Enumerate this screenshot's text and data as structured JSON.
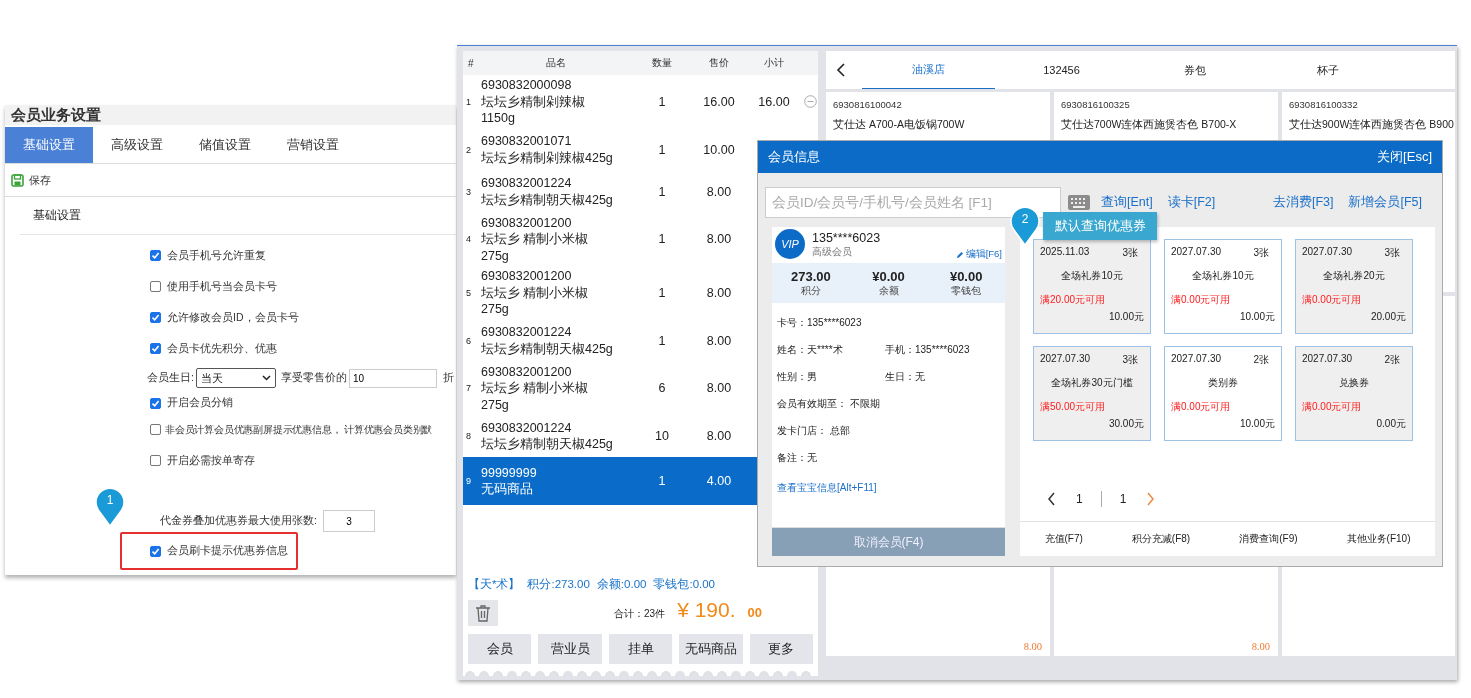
{
  "settings": {
    "title": "会员业务设置",
    "tabs": [
      {
        "label": "基础设置",
        "selected": true
      },
      {
        "label": "高级设置",
        "selected": false
      },
      {
        "label": "储值设置",
        "selected": false
      },
      {
        "label": "营销设置",
        "selected": false
      }
    ],
    "save": "保存",
    "section": "基础设置",
    "options": [
      {
        "kind": "checkbox",
        "label": "会员手机号允许重复",
        "checked": true
      },
      {
        "kind": "checkbox",
        "label": "使用手机号当会员卡号",
        "checked": false
      },
      {
        "kind": "checkbox",
        "label": "允许修改会员ID，会员卡号",
        "checked": true
      },
      {
        "kind": "checkbox",
        "label": "会员卡优先积分、优惠",
        "checked": true
      },
      {
        "kind": "birthday",
        "label": "会员生日:",
        "select": "当天",
        "after": "享受零售价的",
        "value": "10",
        "unit": "折"
      },
      {
        "kind": "checkbox",
        "label": "开启会员分销",
        "checked": true
      },
      {
        "kind": "checkbox",
        "label": "非会员计算会员优惠副屏提示优惠信息， 计算优惠会员类别默",
        "checked": false
      },
      {
        "kind": "checkbox",
        "label": "开启必需按单寄存",
        "checked": false
      },
      {
        "kind": "count",
        "label": "代金券叠加优惠券最大使用张数:",
        "value": "3"
      },
      {
        "kind": "checkbox",
        "label": "会员刷卡提示优惠券信息",
        "checked": true,
        "highlighted": true
      }
    ],
    "callout": {
      "number": "1"
    }
  },
  "cart": {
    "columns": [
      "#",
      "品名",
      "数量",
      "售价",
      "小计"
    ],
    "rows": [
      {
        "index": "1",
        "lines": [
          "6930832000098",
          "坛坛乡精制剁辣椒",
          "1150g"
        ],
        "qty": "1",
        "price": "16.00",
        "subtotal": "16.00",
        "selected": false
      },
      {
        "index": "2",
        "lines": [
          "6930832001071",
          "坛坛乡精制剁辣椒425g"
        ],
        "qty": "1",
        "price": "10.00",
        "selected": false
      },
      {
        "index": "3",
        "lines": [
          "6930832001224",
          "坛坛乡精制朝天椒425g"
        ],
        "qty": "1",
        "price": "8.00",
        "selected": false
      },
      {
        "index": "4",
        "lines": [
          "6930832001200",
          "坛坛乡 精制小米椒",
          "275g"
        ],
        "qty": "1",
        "price": "8.00",
        "selected": false
      },
      {
        "index": "5",
        "lines": [
          "6930832001200",
          "坛坛乡 精制小米椒",
          "275g"
        ],
        "qty": "1",
        "price": "8.00",
        "selected": false
      },
      {
        "index": "6",
        "lines": [
          "6930832001224",
          "坛坛乡精制朝天椒425g"
        ],
        "qty": "1",
        "price": "8.00",
        "selected": false
      },
      {
        "index": "7",
        "lines": [
          "6930832001200",
          "坛坛乡 精制小米椒",
          "275g"
        ],
        "qty": "6",
        "price": "8.00",
        "selected": false
      },
      {
        "index": "8",
        "lines": [
          "6930832001224",
          "坛坛乡精制朝天椒425g"
        ],
        "qty": "10",
        "price": "8.00",
        "selected": false
      },
      {
        "index": "9",
        "lines": [
          "99999999",
          "无码商品"
        ],
        "qty": "1",
        "price": "4.00",
        "selected": true
      }
    ],
    "member_line": [
      "【天*术】",
      "积分:273.00",
      "余额:0.00",
      "零钱包:0.00"
    ],
    "total_label": "合计：23件",
    "total_main": "¥ 190.",
    "total_cents": "00",
    "buttons": [
      "会员",
      "营业员",
      "挂单",
      "无码商品",
      "更多"
    ]
  },
  "catalog": {
    "tabs": [
      {
        "label": "油溪店",
        "selected": true
      },
      {
        "label": "132456",
        "selected": false
      },
      {
        "label": "券包",
        "selected": false
      },
      {
        "label": "杯子",
        "selected": false
      }
    ],
    "products": [
      {
        "code": "6930816100042",
        "name": "艾仕达 A700-A电饭锅700W"
      },
      {
        "code": "6930816100325",
        "name": "艾仕达700W连体西施煲杏色 B700-X"
      },
      {
        "code": "6930816100332",
        "name": "艾仕达900W连体西施煲杏色 B900"
      },
      {
        "price": "8.00"
      },
      {
        "price": "8.00"
      }
    ]
  },
  "member_dialog": {
    "title": "会员信息",
    "close": "关闭[Esc]",
    "search_placeholder": "会员ID/会员号/手机号/会员姓名 [F1]",
    "links": [
      "查询[Ent]",
      "读卡[F2]"
    ],
    "right_links": [
      "去消费[F3]",
      "新增会员[F5]"
    ],
    "callout": {
      "number": "2",
      "text": "默认查询优惠券"
    },
    "member": {
      "badge": "VIP",
      "phone": "135****6023",
      "level": "高级会员",
      "edit": "编辑[F6]",
      "stats": [
        {
          "value": "273.00",
          "label": "积分"
        },
        {
          "value": "¥0.00",
          "label": "余额"
        },
        {
          "value": "¥0.00",
          "label": "零钱包"
        }
      ],
      "info": [
        [
          "卡号：135****6023"
        ],
        [
          "姓名：天****术",
          "手机：135****6023"
        ],
        [
          "性别：男",
          "生日：无"
        ],
        [
          "会员有效期至：  不限期"
        ],
        [
          "发卡门店：   总部"
        ],
        [
          "备注：无"
        ]
      ],
      "link": "查看宝宝信息[Alt+F11]",
      "cancel": "取消会员(F4)"
    },
    "coupons": [
      {
        "date": "2025.11.03",
        "count": "3张",
        "name": "全场礼券10元",
        "condition": "满20.00元可用",
        "amount": "10.00元",
        "shaded": true
      },
      {
        "date": "2027.07.30",
        "count": "3张",
        "name": "全场礼券10元",
        "condition": "满0.00元可用",
        "amount": "10.00元",
        "shaded": false
      },
      {
        "date": "2027.07.30",
        "count": "3张",
        "name": "全场礼券20元",
        "condition": "满0.00元可用",
        "amount": "20.00元",
        "shaded": true
      },
      {
        "date": "2027.07.30",
        "count": "3张",
        "name": "全场礼券30元门槛",
        "condition": "满50.00元可用",
        "amount": "30.00元",
        "shaded": true
      },
      {
        "date": "2027.07.30",
        "count": "2张",
        "name": "类别券",
        "condition": "满0.00元可用",
        "amount": "10.00元",
        "shaded": false
      },
      {
        "date": "2027.07.30",
        "count": "2张",
        "name": "兑换券",
        "condition": "满0.00元可用",
        "amount": "0.00元",
        "shaded": true
      }
    ],
    "pager": {
      "page": "1",
      "total": "1"
    },
    "actions": [
      "充值(F7)",
      "积分充减(F8)",
      "消费查询(F9)",
      "其他业务(F10)"
    ]
  }
}
